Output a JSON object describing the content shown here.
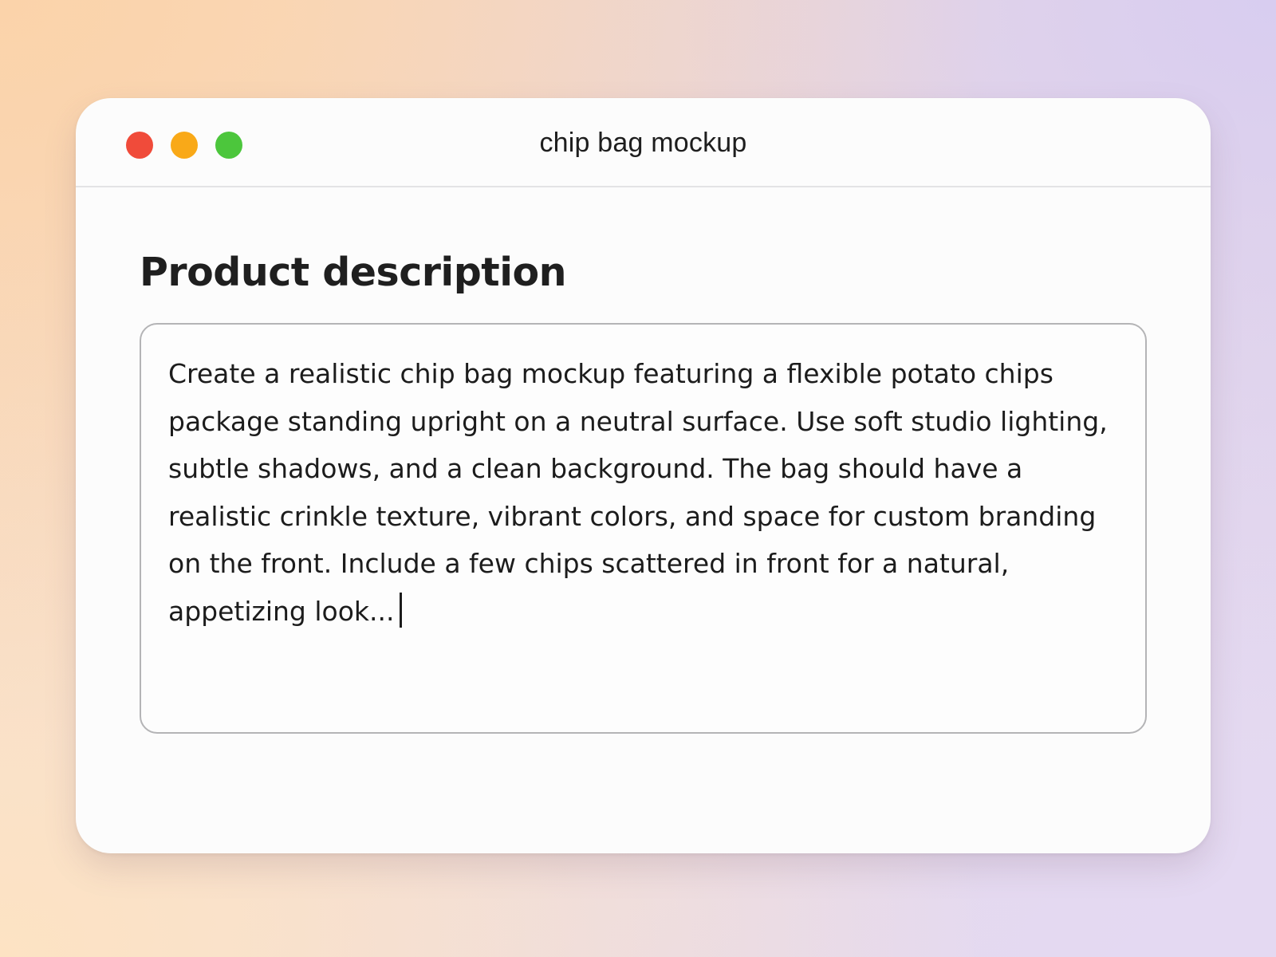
{
  "window": {
    "title": "chip bag mockup",
    "controls": [
      "close",
      "minimize",
      "maximize"
    ]
  },
  "form": {
    "heading": "Product description",
    "description_value": "Create a realistic chip bag mockup featuring a flexible potato chips package standing upright on a neutral surface. Use soft studio lighting, subtle shadows, and a clean background. The bag should have a realistic crinkle texture, vibrant colors, and space for custom branding on the front. Include a few chips scattered in front for a natural, appetizing look..."
  },
  "colors": {
    "close": "#f04b3a",
    "minimize": "#f9a918",
    "maximize": "#4cc63c"
  }
}
